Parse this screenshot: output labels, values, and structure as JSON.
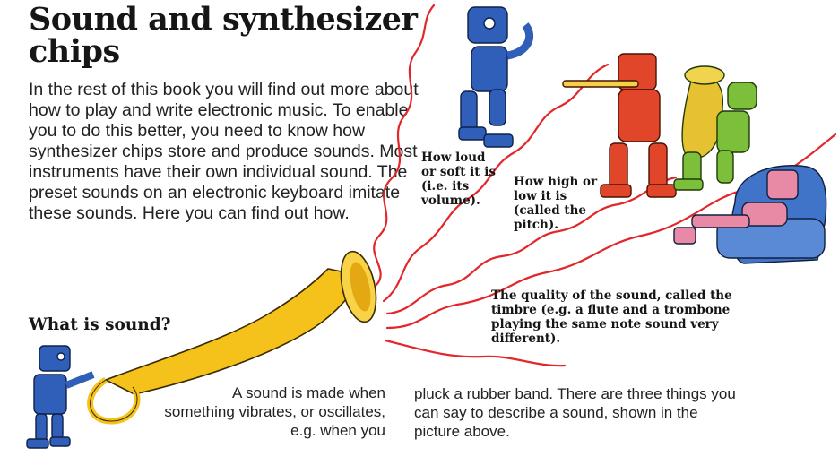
{
  "page": {
    "title": "Sound and synthesizer chips",
    "intro": "In the rest of this book you will find out more about how to play and write electronic music. To enable you to do this better, you need to know how synthesizer chips store and produce sounds. Most instruments have their own individual sound. The preset sounds on an electronic keyboard imitate these sounds. Here you can find out how.",
    "subheading": "What is sound?",
    "captions": {
      "volume": "How loud or soft it is (i.e. its volume).",
      "pitch": "How high or low it is (called the pitch).",
      "timbre": "The quality of the sound, called the timbre (e.g. a flute and a trombone playing the same note sound very different)."
    },
    "body_col1": "A sound is made when something vibrates, or oscillates, e.g. when you",
    "body_col2": "pluck a rubber band. There are three things you can say to describe a sound, shown in the picture above."
  },
  "colors": {
    "wave": "#e3262a",
    "horn": "#f5c21b",
    "robot_blue": "#2f5fb8",
    "robot_red": "#e2462a",
    "robot_green": "#7cbf3a",
    "robot_pink": "#e88aa6"
  },
  "icons": [
    "horn-icon",
    "wave-icon",
    "robot-blue-icon",
    "robot-red-flute-icon",
    "robot-green-tuba-icon",
    "robot-pink-armchair-icon"
  ]
}
